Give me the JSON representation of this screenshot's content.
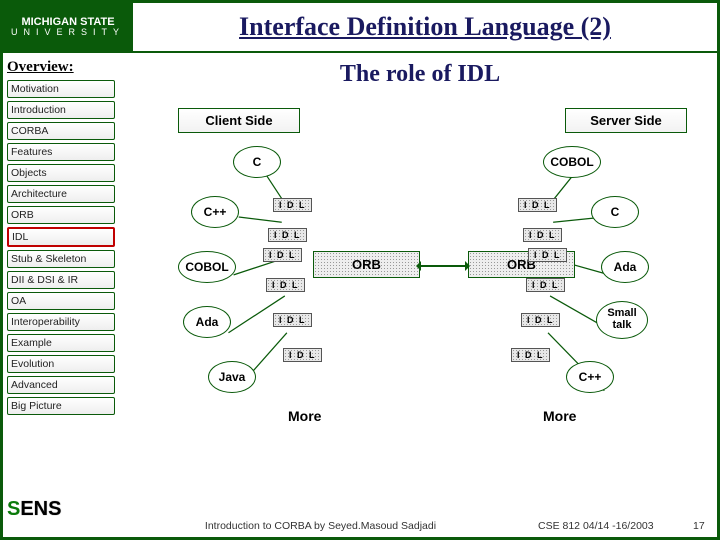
{
  "header": {
    "logo1": "MICHIGAN STATE",
    "logo2": "UNIVERSITY",
    "title": "Interface Definition Language (2)"
  },
  "sidebar": {
    "heading": "Overview:",
    "items": [
      {
        "label": "Motivation"
      },
      {
        "label": "Introduction"
      },
      {
        "label": "CORBA"
      },
      {
        "label": "Features"
      },
      {
        "label": "Objects"
      },
      {
        "label": "Architecture"
      },
      {
        "label": "ORB"
      },
      {
        "label": "IDL"
      },
      {
        "label": "Stub & Skeleton"
      },
      {
        "label": "DII & DSI & IR"
      },
      {
        "label": "OA"
      },
      {
        "label": "Interoperability"
      },
      {
        "label": "Example"
      },
      {
        "label": "Evolution"
      },
      {
        "label": "Advanced"
      },
      {
        "label": "Big Picture"
      }
    ],
    "selected_index": 7
  },
  "content": {
    "subtitle": "The role of IDL",
    "client_label": "Client Side",
    "server_label": "Server Side",
    "orb_label": "ORB",
    "idl_label": "I D L",
    "more_label": "More",
    "client_langs": [
      "C",
      "C++",
      "COBOL",
      "Ada",
      "Java"
    ],
    "server_langs": [
      "COBOL",
      "C",
      "Ada",
      "Small talk",
      "C++"
    ]
  },
  "footer": {
    "center": "Introduction to CORBA by Seyed.Masoud Sadjadi",
    "right": "CSE 812   04/14 -16/2003",
    "page": "17"
  },
  "brand": {
    "s1": "S",
    "s2": "ENS"
  }
}
